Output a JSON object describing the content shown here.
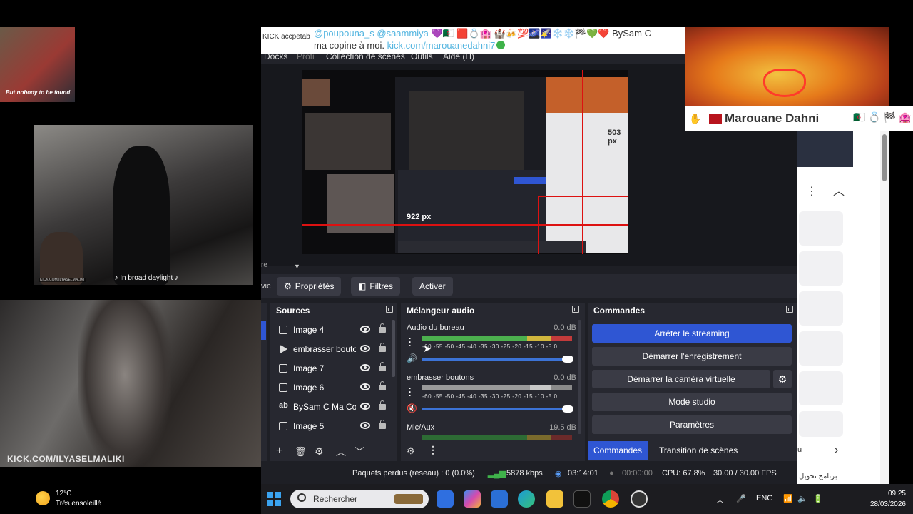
{
  "overlays": {
    "avatar_caption": "But nobody to be found",
    "mj_caption": "♪ In broad daylight ♪",
    "mj_tag": "KICK.COM/ILYASELMALIKI",
    "face_caption": "KICK.COM/ILYASELMALIKI"
  },
  "weather": {
    "temp": "12°C",
    "condition": "Très ensoleillé"
  },
  "chat": {
    "prefix": "KICK accpetab",
    "line1_mentions": "@poupouna_s  @saammiya",
    "line1_emojis": "💜🇩🇿 🟥💍🏩 🏰🍻💯🌌🌠❄️❄️🏁💚❤️",
    "line1_text": " BySam C",
    "line2_text": "ma copine à moi. ",
    "line2_link": "kick.com/marouanedahni7"
  },
  "namebar": {
    "name": "Marouane Dahni",
    "emojis": "🇩🇿 💍 🏁 🏩"
  },
  "obs": {
    "title_partial": "",
    "menu": [
      "Docks",
      "Profi",
      "Collection de scènes",
      "Outils",
      "Aide (H)"
    ],
    "preview_label_px1": "503 px",
    "preview_label_px2": "922 px",
    "scene_truncated": "re",
    "scene_left": "vic",
    "toolbar": {
      "properties": "Propriétés",
      "filters": "Filtres",
      "activate": "Activer"
    },
    "sources": {
      "title": "Sources",
      "items": [
        {
          "icon": "image-icon",
          "name": "Image 4"
        },
        {
          "icon": "play-icon",
          "name": "embrasser bouton"
        },
        {
          "icon": "image-icon",
          "name": "Image 7"
        },
        {
          "icon": "image-icon",
          "name": "Image 6"
        },
        {
          "icon": "text-icon",
          "name": "BySam C Ma Copi"
        },
        {
          "icon": "image-icon",
          "name": "Image 5"
        }
      ]
    },
    "mixer": {
      "title": "Mélangeur audio",
      "channels": [
        {
          "name": "Audio du bureau",
          "db": "0.0 dB",
          "scale": "-60 -55 -50 -45 -40 -35 -30 -25 -20 -15 -10 -5 0"
        },
        {
          "name": "embrasser boutons",
          "db": "0.0 dB",
          "scale": "-60 -55 -50 -45 -40 -35 -30 -25 -20 -15 -10 -5 0"
        },
        {
          "name": "Mic/Aux",
          "db": "19.5 dB"
        }
      ]
    },
    "commands": {
      "title": "Commandes",
      "buttons": [
        "Arrêter le streaming",
        "Démarrer l'enregistrement",
        "Démarrer la caméra virtuelle",
        "Mode studio",
        "Paramètres"
      ],
      "tabs": [
        "Commandes",
        "Transition de scènes"
      ]
    },
    "status": {
      "dropped": "Paquets perdus (réseau) : 0 (0.0%)",
      "bitrate": "5878 kbps",
      "stream_time": "03:14:01",
      "rec_time": "00:00:00",
      "cpu": "CPU: 67.8%",
      "fps": "30.00 / 30.00 FPS"
    }
  },
  "browser": {
    "snippet_u": "u",
    "snippet_ar": "برنامج تحویل"
  },
  "taskbar": {
    "search_placeholder": "Rechercher",
    "lang": "ENG",
    "time": "09:25",
    "date": "28/03/2026"
  },
  "colors": {
    "accent": "#2f56d3",
    "obs_bg": "#1e1f25",
    "dock_bg": "#272830",
    "link": "#53b5e0",
    "live_red": "#d11111"
  }
}
